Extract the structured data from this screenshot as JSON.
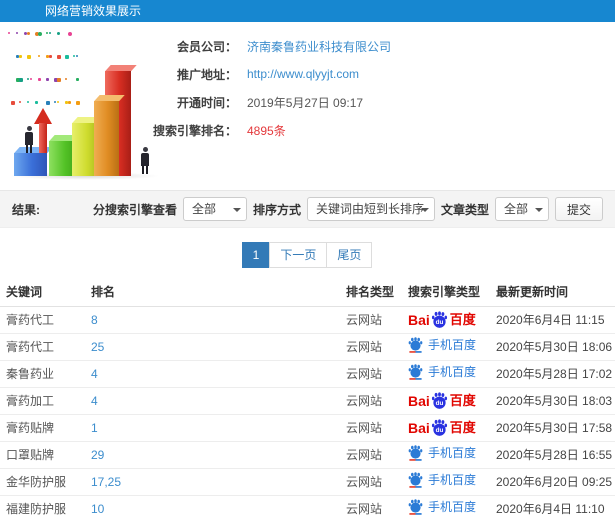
{
  "title_bar": {
    "title": "网络营销效果展示"
  },
  "member_info": {
    "fields": [
      {
        "label": "会员公司：",
        "value": "济南秦鲁药业科技有限公司",
        "style": "link"
      },
      {
        "label": "推广地址：",
        "value": "http://www.qlyyjt.com",
        "style": "link"
      },
      {
        "label": "开通时间：",
        "value": "2019年5月27日 09:17",
        "style": "text"
      },
      {
        "label": "搜索引擎排名：",
        "value": "4895条",
        "style": "red"
      }
    ]
  },
  "filters": {
    "result_label": "结果:",
    "engine_view_label": "分搜索引擎查看",
    "engine_view_value": "全部",
    "sort_label": "排序方式",
    "sort_value": "关键词由短到长排序",
    "article_type_label": "文章类型",
    "article_type_value": "全部",
    "submit_label": "提交"
  },
  "pagination": {
    "current": "1",
    "next_label": "下一页",
    "last_label": "尾页"
  },
  "table": {
    "headers": [
      "关键词",
      "排名",
      "排名类型",
      "搜索引擎类型",
      "最新更新时间"
    ],
    "rows": [
      {
        "keyword": "膏药代工",
        "rank": "8",
        "rank_type": "云网站",
        "engine": "baidu",
        "time": "2020年6月4日 11:15"
      },
      {
        "keyword": "膏药代工",
        "rank": "25",
        "rank_type": "云网站",
        "engine": "mobile_baidu",
        "time": "2020年5月30日 18:06"
      },
      {
        "keyword": "秦鲁药业",
        "rank": "4",
        "rank_type": "云网站",
        "engine": "mobile_baidu",
        "time": "2020年5月28日 17:02"
      },
      {
        "keyword": "膏药加工",
        "rank": "4",
        "rank_type": "云网站",
        "engine": "baidu",
        "time": "2020年5月30日 18:03"
      },
      {
        "keyword": "膏药贴牌",
        "rank": "1",
        "rank_type": "云网站",
        "engine": "baidu",
        "time": "2020年5月30日 17:58"
      },
      {
        "keyword": "口罩贴牌",
        "rank": "29",
        "rank_type": "云网站",
        "engine": "mobile_baidu",
        "time": "2020年5月28日 16:55"
      },
      {
        "keyword": "金华防护服",
        "rank": "17,25",
        "rank_type": "云网站",
        "engine": "mobile_baidu",
        "time": "2020年6月20日 09:25"
      },
      {
        "keyword": "福建防护服",
        "rank": "10",
        "rank_type": "云网站",
        "engine": "mobile_baidu",
        "time": "2020年6月4日 11:10"
      }
    ],
    "engines": {
      "baidu": {
        "text_bai": "Bai",
        "text_du": "du",
        "text_cn": "百度"
      },
      "mobile_baidu": {
        "label": "手机百度"
      }
    }
  },
  "colors": {
    "header_blue": "#1787d0",
    "link_blue": "#3c8dcd",
    "highlight_red": "#e4393c",
    "pagination_blue": "#337ab7",
    "baidu_red": "#e10601",
    "baidu_paw_blue": "#2932e1",
    "mobile_baidu_blue": "#2b7bd6"
  }
}
